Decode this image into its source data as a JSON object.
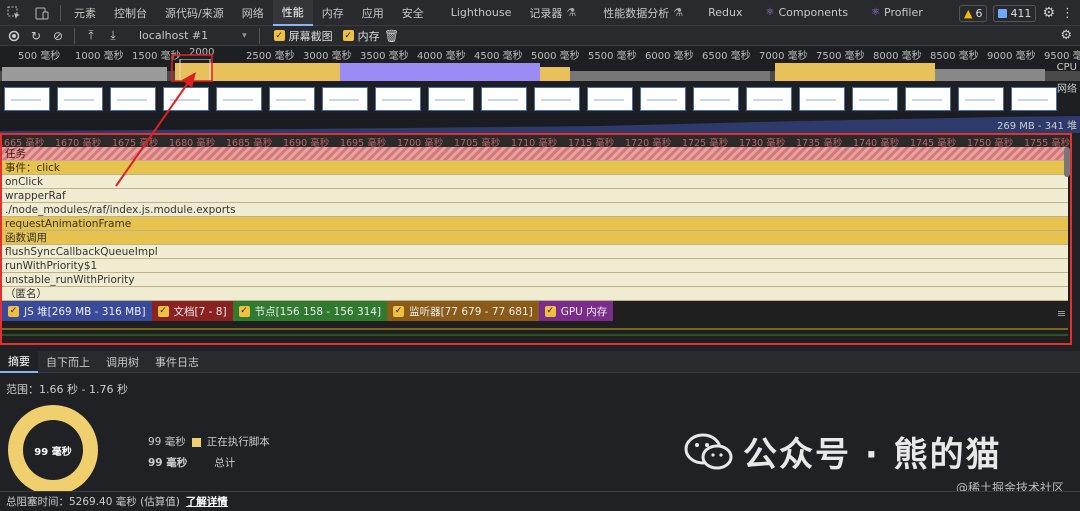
{
  "tabbar": {
    "tabs": [
      {
        "label": "元素"
      },
      {
        "label": "控制台"
      },
      {
        "label": "源代码/来源"
      },
      {
        "label": "网络"
      },
      {
        "label": "性能"
      },
      {
        "label": "内存"
      },
      {
        "label": "应用"
      },
      {
        "label": "安全"
      },
      {
        "label": "Lighthouse"
      },
      {
        "label": "记录器"
      },
      {
        "label": "性能数据分析"
      },
      {
        "label": "Redux"
      },
      {
        "label": "Components"
      },
      {
        "label": "Profiler"
      }
    ],
    "active_tab": "性能",
    "warnings_count": "6",
    "issues_count": "411"
  },
  "toolbar": {
    "target": "localhost #1",
    "screenshots_label": "屏幕截图",
    "memory_label": "内存"
  },
  "overview": {
    "ruler_ticks": [
      "500 毫秒",
      "1000 毫秒",
      "1500 毫秒",
      "2000",
      "2500 毫秒",
      "3000 毫秒",
      "3500 毫秒",
      "4000 毫秒",
      "4500 毫秒",
      "5000 毫秒",
      "5500 毫秒",
      "6000 毫秒",
      "6500 毫秒",
      "7000 毫秒",
      "7500 毫秒",
      "8000 毫秒",
      "8500 毫秒",
      "9000 毫秒",
      "9500 毫秒"
    ],
    "cpu_label": "CPU",
    "net_label": "网络",
    "heap_label": "堆",
    "heap_range": "269 MB - 341"
  },
  "flame": {
    "ms_ticks": [
      "1665 毫秒",
      "1670 毫秒",
      "1675 毫秒",
      "1680 毫秒",
      "1685 毫秒",
      "1690 毫秒",
      "1695 毫秒",
      "1700 毫秒",
      "1705 毫秒",
      "1710 毫秒",
      "1715 毫秒",
      "1720 毫秒",
      "1725 毫秒",
      "1730 毫秒",
      "1735 毫秒",
      "1740 毫秒",
      "1745 毫秒",
      "1750 毫秒",
      "1755 毫秒"
    ],
    "rows": [
      {
        "label": "任务"
      },
      {
        "label": "事件：click"
      },
      {
        "label": "onClick"
      },
      {
        "label": "wrapperRaf"
      },
      {
        "label": "./node_modules/raf/index.js.module.exports"
      },
      {
        "label": "requestAnimationFrame"
      },
      {
        "label": "函数调用"
      },
      {
        "label": "flushSyncCallbackQueueImpl"
      },
      {
        "label": "runWithPriority$1"
      },
      {
        "label": "unstable_runWithPriority"
      },
      {
        "label": "（匿名）"
      }
    ],
    "legend": [
      {
        "label": "JS 堆[269 MB - 316 MB]"
      },
      {
        "label": "文档[7 - 8]"
      },
      {
        "label": "节点[156 158 - 156 314]"
      },
      {
        "label": "监听器[77 679 - 77 681]"
      },
      {
        "label": "GPU 内存"
      }
    ]
  },
  "bottom_tabs": [
    {
      "label": "摘要"
    },
    {
      "label": "自下而上"
    },
    {
      "label": "调用树"
    },
    {
      "label": "事件日志"
    }
  ],
  "summary": {
    "range": "范围：1.66 秒 - 1.76 秒",
    "donut_label": "99 毫秒",
    "scripting_value": "99 毫秒",
    "scripting_label": "正在执行脚本",
    "total_value": "99 毫秒",
    "total_label": "总计"
  },
  "footer": {
    "blocking_time": "总阻塞时间：5269.40 毫秒 (估算值)",
    "learn_more": "了解详情"
  },
  "watermark": {
    "text": "公众号 · 熊的猫",
    "credit": "@稀土掘金技术社区"
  },
  "colors": {
    "accent": "#8ab4f8",
    "scripting": "#f0cf6e",
    "rendering": "#9b8cf5",
    "highlight_box": "#e03030"
  }
}
